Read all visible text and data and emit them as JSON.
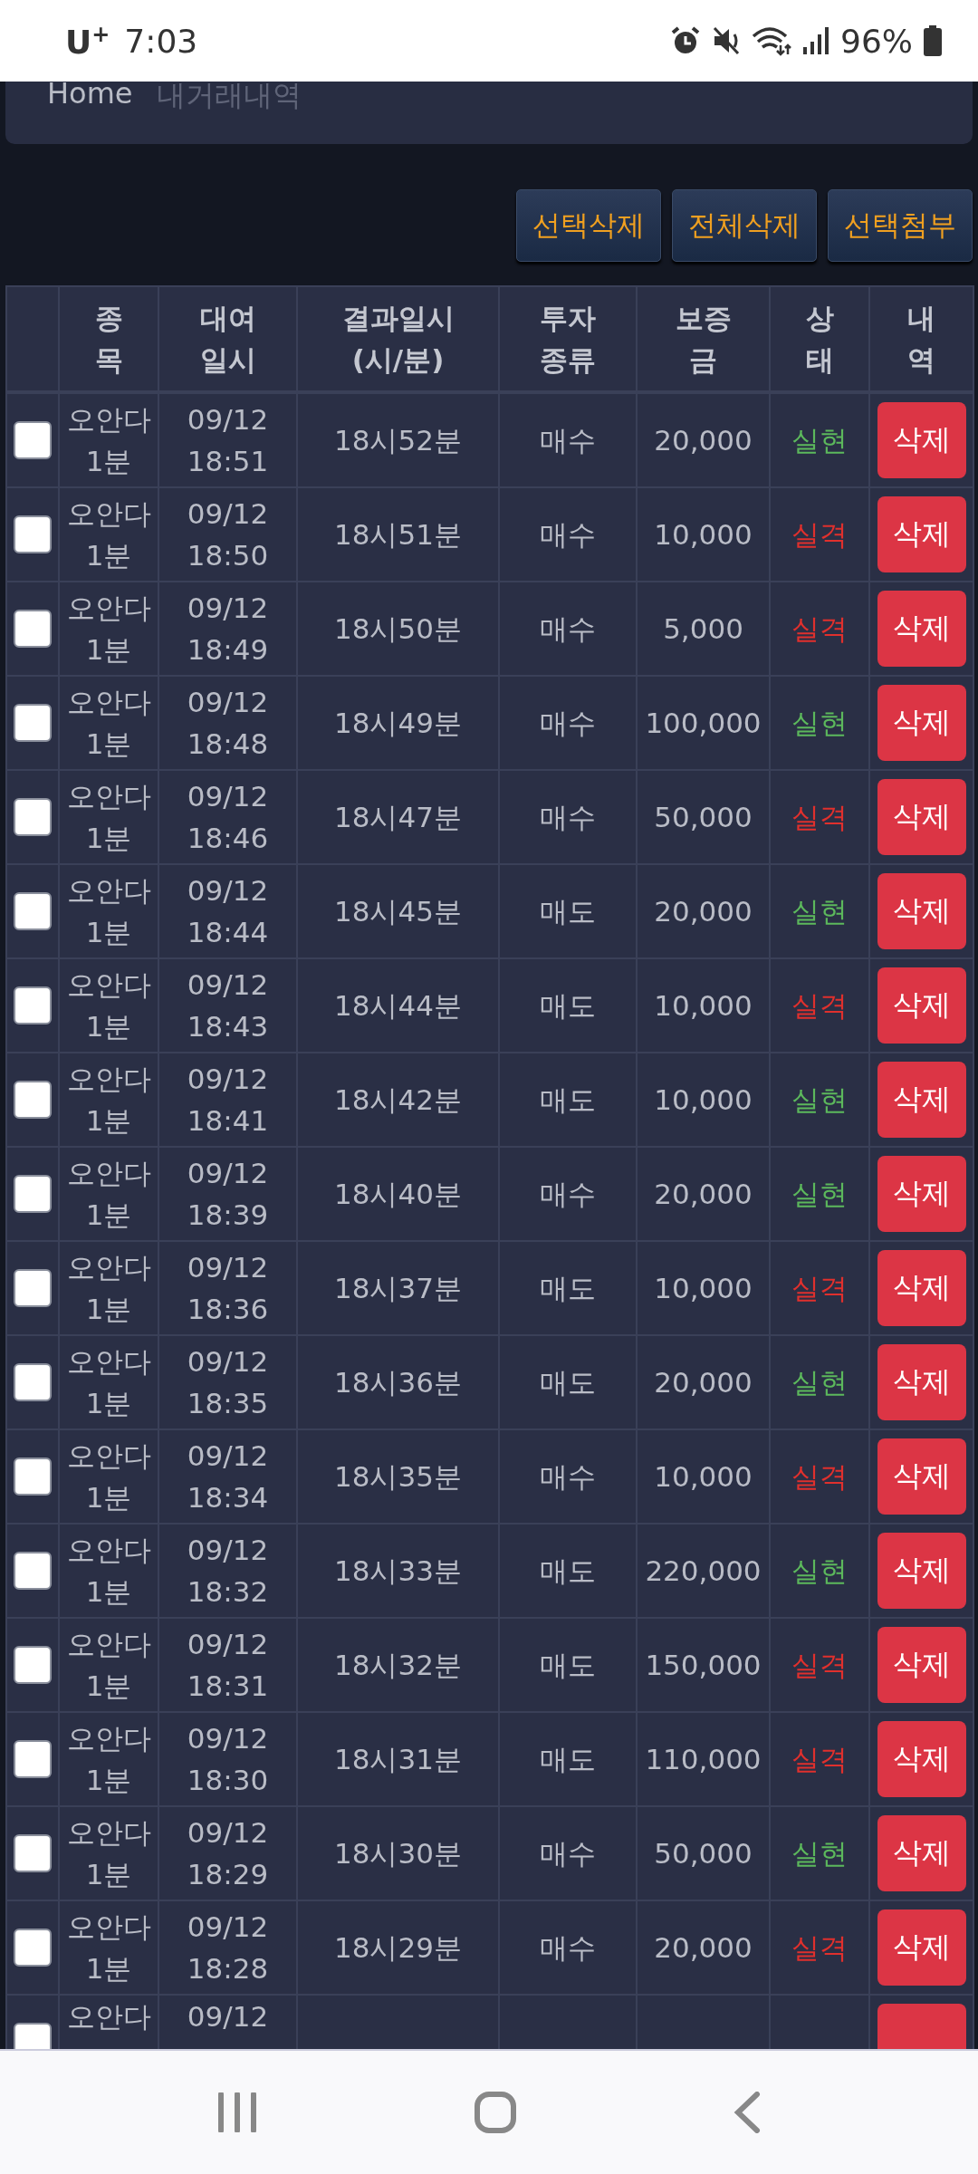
{
  "status_bar": {
    "carrier": "U$^{+}$",
    "time": "7:03",
    "battery": "96%"
  },
  "breadcrumb": {
    "home": "Home",
    "current": "내거래내역"
  },
  "actions": [
    "선택삭제",
    "전체삭제",
    "선택첨부"
  ],
  "table": {
    "columns": [
      {
        "lines": [
          "종",
          "목"
        ]
      },
      {
        "lines": [
          "대여",
          "일시"
        ]
      },
      {
        "lines": [
          "결과일시",
          "(시/분)"
        ]
      },
      {
        "lines": [
          "투자",
          "종류"
        ]
      },
      {
        "lines": [
          "보증",
          "금"
        ]
      },
      {
        "lines": [
          "상",
          "태"
        ]
      },
      {
        "lines": [
          "내",
          "역"
        ]
      }
    ],
    "rows": [
      {
        "checked": false,
        "item": "오안다 1분",
        "date": "09/12 18:51",
        "result_time": "18시52분",
        "type": "매수",
        "amount": "20,000",
        "status": "실현",
        "color": "#5cb85c",
        "action": "삭제"
      },
      {
        "checked": false,
        "item": "오안다 1분",
        "date": "09/12 18:50",
        "result_time": "18시51분",
        "type": "매수",
        "amount": "10,000",
        "status": "실격",
        "color": "#e0302d",
        "action": "삭제"
      },
      {
        "checked": false,
        "item": "오안다 1분",
        "date": "09/12 18:49",
        "result_time": "18시50분",
        "type": "매수",
        "amount": "5,000",
        "status": "실격",
        "color": "#e0302d",
        "action": "삭제"
      },
      {
        "checked": false,
        "item": "오안다 1분",
        "date": "09/12 18:48",
        "result_time": "18시49분",
        "type": "매수",
        "amount": "100,000",
        "status": "실현",
        "color": "#5cb85c",
        "action": "삭제"
      },
      {
        "checked": false,
        "item": "오안다 1분",
        "date": "09/12 18:46",
        "result_time": "18시47분",
        "type": "매수",
        "amount": "50,000",
        "status": "실격",
        "color": "#e0302d",
        "action": "삭제"
      },
      {
        "checked": false,
        "item": "오안다 1분",
        "date": "09/12 18:44",
        "result_time": "18시45분",
        "type": "매도",
        "amount": "20,000",
        "status": "실현",
        "color": "#5cb85c",
        "action": "삭제"
      },
      {
        "checked": false,
        "item": "오안다 1분",
        "date": "09/12 18:43",
        "result_time": "18시44분",
        "type": "매도",
        "amount": "10,000",
        "status": "실격",
        "color": "#e0302d",
        "action": "삭제"
      },
      {
        "checked": false,
        "item": "오안다 1분",
        "date": "09/12 18:41",
        "result_time": "18시42분",
        "type": "매도",
        "amount": "10,000",
        "status": "실현",
        "color": "#5cb85c",
        "action": "삭제"
      },
      {
        "checked": false,
        "item": "오안다 1분",
        "date": "09/12 18:39",
        "result_time": "18시40분",
        "type": "매수",
        "amount": "20,000",
        "status": "실현",
        "color": "#5cb85c",
        "action": "삭제"
      },
      {
        "checked": false,
        "item": "오안다 1분",
        "date": "09/12 18:36",
        "result_time": "18시37분",
        "type": "매도",
        "amount": "10,000",
        "status": "실격",
        "color": "#e0302d",
        "action": "삭제"
      },
      {
        "checked": false,
        "item": "오안다 1분",
        "date": "09/12 18:35",
        "result_time": "18시36분",
        "type": "매도",
        "amount": "20,000",
        "status": "실현",
        "color": "#5cb85c",
        "action": "삭제"
      },
      {
        "checked": false,
        "item": "오안다 1분",
        "date": "09/12 18:34",
        "result_time": "18시35분",
        "type": "매수",
        "amount": "10,000",
        "status": "실격",
        "color": "#e0302d",
        "action": "삭제"
      },
      {
        "checked": false,
        "item": "오안다 1분",
        "date": "09/12 18:32",
        "result_time": "18시33분",
        "type": "매도",
        "amount": "220,000",
        "status": "실현",
        "color": "#5cb85c",
        "action": "삭제"
      },
      {
        "checked": false,
        "item": "오안다 1분",
        "date": "09/12 18:31",
        "result_time": "18시32분",
        "type": "매도",
        "amount": "150,000",
        "status": "실격",
        "color": "#e0302d",
        "action": "삭제"
      },
      {
        "checked": false,
        "item": "오안다 1분",
        "date": "09/12 18:30",
        "result_time": "18시31분",
        "type": "매도",
        "amount": "110,000",
        "status": "실격",
        "color": "#e0302d",
        "action": "삭제"
      },
      {
        "checked": false,
        "item": "오안다 1분",
        "date": "09/12 18:29",
        "result_time": "18시30분",
        "type": "매수",
        "amount": "50,000",
        "status": "실현",
        "color": "#5cb85c",
        "action": "삭제"
      },
      {
        "checked": false,
        "item": "오안다 1분",
        "date": "09/12 18:28",
        "result_time": "18시29분",
        "type": "매수",
        "amount": "20,000",
        "status": "실격",
        "color": "#e0302d",
        "action": "삭제"
      },
      {
        "checked": false,
        "item": "오안다",
        "date": "09/12"
      }
    ]
  }
}
